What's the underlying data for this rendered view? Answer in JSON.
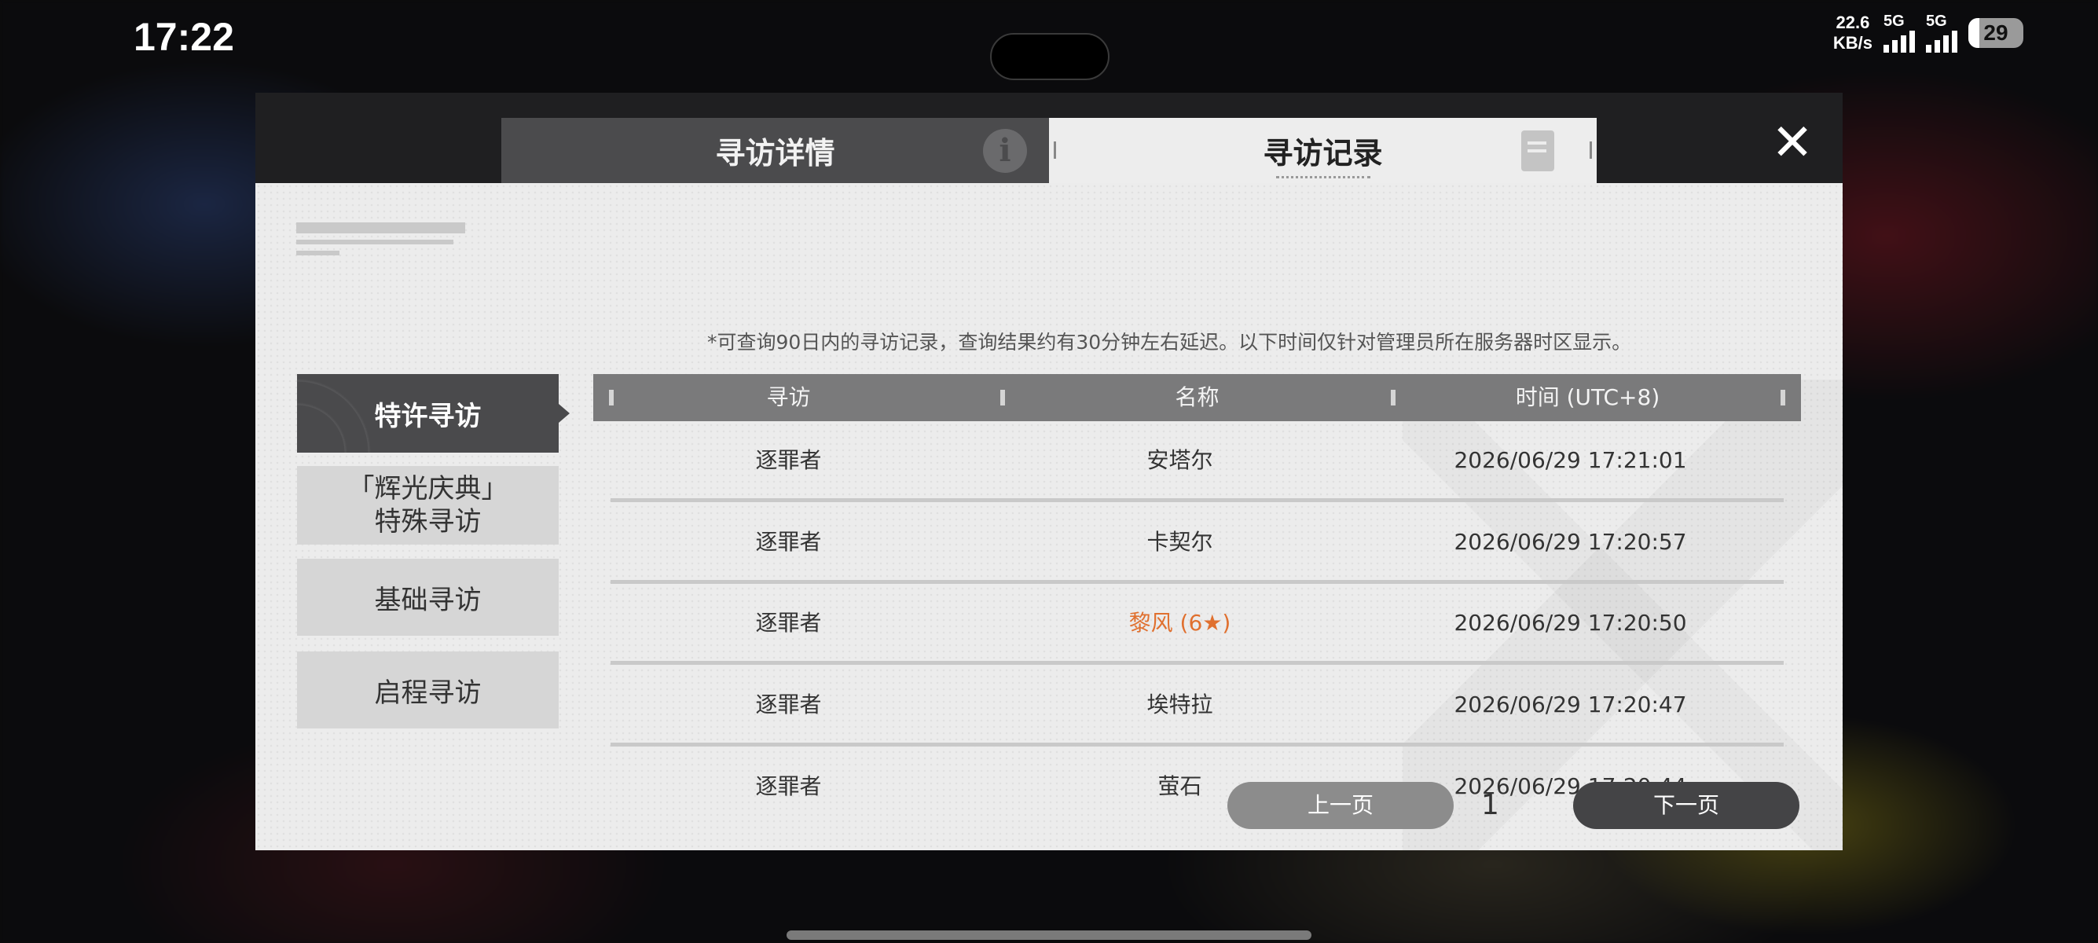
{
  "status_bar": {
    "time": "17:22",
    "net_speed_top": "22.6",
    "net_speed_bottom": "KB/s",
    "sim1_label": "5G",
    "sim2_label": "5G",
    "battery": "29"
  },
  "dialog": {
    "tabs": [
      {
        "label": "寻访详情",
        "active": false,
        "icon": "info-icon"
      },
      {
        "label": "寻访记录",
        "active": true,
        "icon": "document-icon"
      }
    ],
    "close_icon": "✕",
    "sidebar": [
      {
        "label": "特许寻访",
        "active": true
      },
      {
        "label": "「辉光庆典」\n特殊寻访",
        "active": false
      },
      {
        "label": "基础寻访",
        "active": false
      },
      {
        "label": "启程寻访",
        "active": false
      }
    ],
    "notice": "*可查询90日内的寻访记录，查询结果约有30分钟左右延迟。以下时间仅针对管理员所在服务器时区显示。",
    "table": {
      "headers": [
        "寻访",
        "名称",
        "时间 (UTC+8)"
      ],
      "rows": [
        {
          "banner": "逐罪者",
          "name": "安塔尔",
          "time": "2026/06/29 17:21:01",
          "highlight": false
        },
        {
          "banner": "逐罪者",
          "name": "卡契尔",
          "time": "2026/06/29 17:20:57",
          "highlight": false
        },
        {
          "banner": "逐罪者",
          "name": "黎风 (6★)",
          "time": "2026/06/29 17:20:50",
          "highlight": true
        },
        {
          "banner": "逐罪者",
          "name": "埃特拉",
          "time": "2026/06/29 17:20:47",
          "highlight": false
        },
        {
          "banner": "逐罪者",
          "name": "萤石",
          "time": "2026/06/29 17:20:44",
          "highlight": false
        }
      ]
    },
    "pager": {
      "prev_label": "上一页",
      "page": "1",
      "next_label": "下一页"
    },
    "colors": {
      "highlight": "#e0702f",
      "header_bg": "#7a7a7b",
      "active_side_bg": "#4a4a4c"
    }
  }
}
